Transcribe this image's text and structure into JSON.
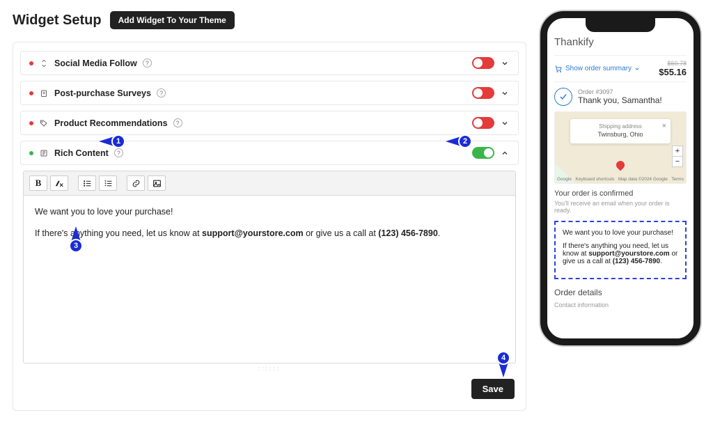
{
  "header": {
    "title": "Widget Setup",
    "theme_button": "Add Widget To Your Theme"
  },
  "rows": {
    "social": {
      "label": "Social Media Follow"
    },
    "survey": {
      "label": "Post-purchase Surveys"
    },
    "recs": {
      "label": "Product Recommendations"
    },
    "rich": {
      "label": "Rich Content"
    }
  },
  "editor": {
    "line1": "We want you to love your purchase!",
    "line2_a": "If there's anything you need, let us know at ",
    "line2_email": "support@yourstore.com",
    "line2_b": " or give us a call at ",
    "line2_phone": "(123) 456-7890",
    "line2_c": "."
  },
  "buttons": {
    "save": "Save"
  },
  "callouts": {
    "c1": "1",
    "c2": "2",
    "c3": "3",
    "c4": "4"
  },
  "phone": {
    "app_name": "Thankify",
    "summary_link": "Show order summary",
    "strike_price": "$60.78",
    "price": "$55.16",
    "order_num": "Order #3097",
    "thank_you": "Thank you, Samantha!",
    "map": {
      "close": "×",
      "label": "Shipping address",
      "city": "Twinsburg, Ohio",
      "plus": "+",
      "minus": "−",
      "google": "Google",
      "kbd": "Keyboard shortcuts",
      "attrib": "Map data ©2024 Google",
      "terms": "Terms"
    },
    "confirmed_title": "Your order is confirmed",
    "confirmed_sub": "You'll receive an email when your order is ready.",
    "rich": {
      "p1": "We want you to love your purchase!",
      "p2a": "If there's anything you need, let us know at ",
      "p2email": "support@yourstore.com",
      "p2b": " or give us a call at ",
      "p2phone": "(123) 456-7890",
      "p2c": "."
    },
    "details_title": "Order details",
    "contact_label": "Contact information"
  }
}
